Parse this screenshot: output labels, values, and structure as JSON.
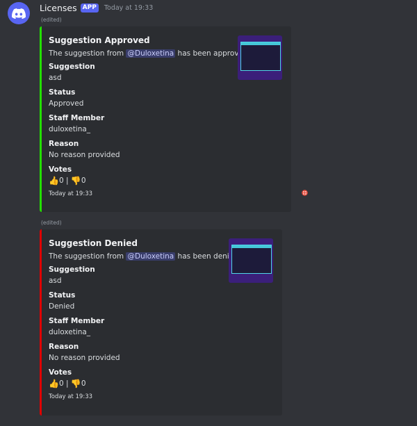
{
  "author": {
    "name": "Licenses",
    "badge": "APP",
    "time": "Today at 19:33"
  },
  "edited_label": "(edited)",
  "embeds": [
    {
      "color": "#23a559",
      "title": "Suggestion Approved",
      "desc_before": "The suggestion from ",
      "mention": "@Duloxetina",
      "desc_after": " has been approved!",
      "fields": {
        "suggestion_name": "Suggestion",
        "suggestion_value": "asd",
        "status_name": "Status",
        "status_value": "Approved",
        "staff_name": "Staff Member",
        "staff_value": "duloxetina_",
        "reason_name": "Reason",
        "reason_value": "No reason provided",
        "votes_name": "Votes",
        "votes_up": "0",
        "votes_sep": "|",
        "votes_down": "0"
      },
      "footer": "Today at 19:33"
    },
    {
      "color": "#da373c",
      "title": "Suggestion Denied",
      "desc_before": "The suggestion from ",
      "mention": "@Duloxetina",
      "desc_after": " has been denied!",
      "fields": {
        "suggestion_name": "Suggestion",
        "suggestion_value": "asd",
        "status_name": "Status",
        "status_value": "Denied",
        "staff_name": "Staff Member",
        "staff_value": "duloxetina_",
        "reason_name": "Reason",
        "reason_value": "No reason provided",
        "votes_name": "Votes",
        "votes_up": "0",
        "votes_sep": "|",
        "votes_down": "0"
      },
      "footer": "Today at 19:33"
    }
  ],
  "icons": {
    "avatar": "discord-logo-icon",
    "thumbs_up": "👍",
    "thumbs_down": "👎"
  }
}
